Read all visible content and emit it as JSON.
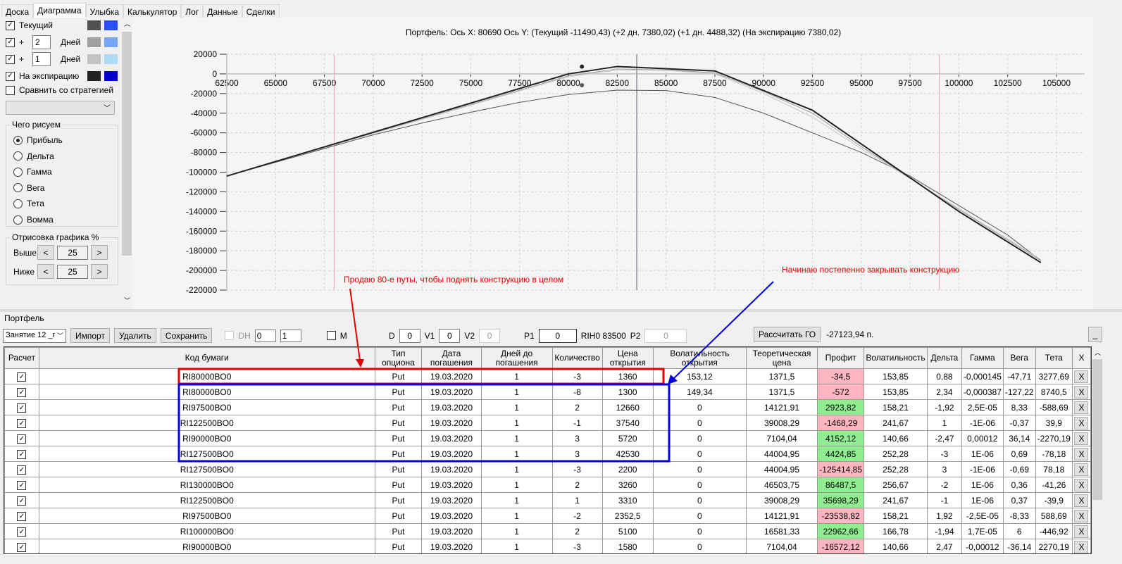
{
  "tabs": [
    "Доска",
    "Диаграмма",
    "Улыбка",
    "Калькулятор",
    "Лог",
    "Данные",
    "Сделки"
  ],
  "left": {
    "curves": [
      {
        "label": "Текущий",
        "checked": true,
        "days": null,
        "color1": "#505050",
        "color2": "#2a4ff5"
      },
      {
        "label": "+",
        "checked": true,
        "days": "2",
        "days_label": "Дней",
        "color1": "#a0a0a0",
        "color2": "#78a6f2"
      },
      {
        "label": "+",
        "checked": true,
        "days": "1",
        "days_label": "Дней",
        "color1": "#c3c3c3",
        "color2": "#aedaf7"
      },
      {
        "label": "На экспирацию",
        "checked": true,
        "days": null,
        "color1": "#222222",
        "color2": "#0000c8"
      }
    ],
    "compare_label": "Сравнить со стратегией",
    "draw_group": "Чего рисуем",
    "draw_options": [
      "Прибыль",
      "Дельта",
      "Гамма",
      "Вега",
      "Тета",
      "Вомма"
    ],
    "draw_selected": 0,
    "range_group": "Отрисовка графика %",
    "above_label": "Выше",
    "above_value": "25",
    "below_label": "Ниже",
    "below_value": "25",
    "prev": "<",
    "next": ">"
  },
  "chart_data": {
    "type": "line",
    "title": "Портфель: Ось X: 80690 Ось Y:  (Текущий -11490,43)  (+2 дн. 7380,02)  (+1 дн. 4488,32)  (На экспирацию 7380,02)",
    "xlim": [
      62500,
      105000
    ],
    "ylim": [
      -220000,
      20000
    ],
    "xticks": [
      62500,
      65000,
      67500,
      70000,
      72500,
      75000,
      77500,
      80000,
      82500,
      85000,
      87500,
      90000,
      92500,
      95000,
      97500,
      100000,
      102500,
      105000
    ],
    "yticks": [
      20000,
      0,
      -20000,
      -40000,
      -60000,
      -80000,
      -100000,
      -120000,
      -140000,
      -160000,
      -180000,
      -200000,
      -220000
    ],
    "grid": true,
    "vlines": [
      {
        "x": 68000,
        "color": "#f4a0a8"
      },
      {
        "x": 83500,
        "color": "#a0aab8"
      },
      {
        "x": 99000,
        "color": "#f4a0a8"
      }
    ],
    "series": [
      {
        "color": "#555555",
        "width": 1,
        "points": [
          [
            62500,
            -104000
          ],
          [
            65000,
            -90000
          ],
          [
            67500,
            -76000
          ],
          [
            70000,
            -62000
          ],
          [
            72500,
            -50000
          ],
          [
            75000,
            -39000
          ],
          [
            77500,
            -29000
          ],
          [
            80000,
            -21000
          ],
          [
            82500,
            -16500
          ],
          [
            85000,
            -17000
          ],
          [
            87500,
            -24000
          ],
          [
            90000,
            -40000
          ],
          [
            92500,
            -60000
          ],
          [
            95000,
            -80000
          ],
          [
            97500,
            -104000
          ],
          [
            100000,
            -134000
          ],
          [
            102500,
            -164000
          ],
          [
            104200,
            -190000
          ]
        ]
      },
      {
        "color": "#a0a0a0",
        "width": 1,
        "points": [
          [
            62500,
            -104000
          ],
          [
            80000,
            -2000
          ],
          [
            82500,
            5000
          ],
          [
            85000,
            4000
          ],
          [
            87500,
            1000
          ],
          [
            90000,
            -18000
          ],
          [
            92500,
            -40000
          ],
          [
            95000,
            -74000
          ],
          [
            100000,
            -138000
          ],
          [
            104200,
            -190000
          ]
        ]
      },
      {
        "color": "#c8c8c8",
        "width": 1,
        "points": [
          [
            62500,
            -104000
          ],
          [
            80000,
            -3000
          ],
          [
            82500,
            4000
          ],
          [
            85000,
            3500
          ],
          [
            87500,
            0
          ],
          [
            90000,
            -20000
          ],
          [
            92500,
            -44000
          ],
          [
            95000,
            -76000
          ],
          [
            100000,
            -137000
          ],
          [
            104200,
            -189000
          ]
        ]
      },
      {
        "color": "#222222",
        "width": 2,
        "points": [
          [
            62500,
            -104000
          ],
          [
            80000,
            0
          ],
          [
            82500,
            7500
          ],
          [
            87500,
            3000
          ],
          [
            92500,
            -37000
          ],
          [
            100000,
            -140000
          ],
          [
            104200,
            -192000
          ]
        ]
      }
    ],
    "markers": [
      {
        "x": 80690,
        "y": 7380,
        "color": "#222222"
      },
      {
        "x": 80690,
        "y": -11490,
        "color": "#555555"
      }
    ]
  },
  "annotations": {
    "red_text": "Продаю 80-е путы, чтобы поднять конструкцию в целом",
    "blue_text": "Начинаю постепенно закрывать конструкцию"
  },
  "portfolio": {
    "group_label": "Портфель",
    "select": "Занятие 12 _г",
    "import": "Импорт",
    "delete": "Удалить",
    "save": "Сохранить",
    "dh": "DH",
    "spin1": "0",
    "spin2": "1",
    "m": "M",
    "d_label": "D",
    "d": "0",
    "v1_label": "V1",
    "v1": "0",
    "v2_label": "V2",
    "v2": "0",
    "p1_label": "P1",
    "p1": "0",
    "rih": "RIH0 83500",
    "p2_label": "P2",
    "p2": "0",
    "calc": "Рассчитать ГО",
    "go_value": "-27123,94 п.",
    "minimize": "_"
  },
  "table": {
    "headers": [
      "Расчет",
      "Код бумаги",
      "Тип опциона",
      "Дата погашения",
      "Дней до погашения",
      "Количество",
      "Цена открытия",
      "Волатильность открытия",
      "Теоретическая цена",
      "Профит",
      "Волатильность",
      "Дельта",
      "Гамма",
      "Вега",
      "Тета",
      "X"
    ],
    "rows": [
      [
        "RI80000BO0",
        "Put",
        "19.03.2020",
        "1",
        "-3",
        "1360",
        "153,12",
        "1371,5",
        "-34,5",
        "153,85",
        "0,88",
        "-0,000145",
        "-47,71",
        "3277,69"
      ],
      [
        "RI80000BO0",
        "Put",
        "19.03.2020",
        "1",
        "-8",
        "1300",
        "149,34",
        "1371,5",
        "-572",
        "153,85",
        "2,34",
        "-0,000387",
        "-127,22",
        "8740,5"
      ],
      [
        "RI97500BO0",
        "Put",
        "19.03.2020",
        "1",
        "2",
        "12660",
        "0",
        "14121,91",
        "2923,82",
        "158,21",
        "-1,92",
        "2,5E-05",
        "8,33",
        "-588,69"
      ],
      [
        "RI122500BO0",
        "Put",
        "19.03.2020",
        "1",
        "-1",
        "37540",
        "0",
        "39008,29",
        "-1468,29",
        "241,67",
        "1",
        "-1E-06",
        "-0,37",
        "39,9"
      ],
      [
        "RI90000BO0",
        "Put",
        "19.03.2020",
        "1",
        "3",
        "5720",
        "0",
        "7104,04",
        "4152,12",
        "140,66",
        "-2,47",
        "0,00012",
        "36,14",
        "-2270,19"
      ],
      [
        "RI127500BO0",
        "Put",
        "19.03.2020",
        "1",
        "3",
        "42530",
        "0",
        "44004,95",
        "4424,85",
        "252,28",
        "-3",
        "1E-06",
        "0,69",
        "-78,18"
      ],
      [
        "RI127500BO0",
        "Put",
        "19.03.2020",
        "1",
        "-3",
        "2200",
        "0",
        "44004,95",
        "-125414,85",
        "252,28",
        "3",
        "-1E-06",
        "-0,69",
        "78,18"
      ],
      [
        "RI130000BO0",
        "Put",
        "19.03.2020",
        "1",
        "2",
        "3260",
        "0",
        "46503,75",
        "86487,5",
        "256,67",
        "-2",
        "1E-06",
        "0,36",
        "-41,26"
      ],
      [
        "RI122500BO0",
        "Put",
        "19.03.2020",
        "1",
        "1",
        "3310",
        "0",
        "39008,29",
        "35698,29",
        "241,67",
        "-1",
        "1E-06",
        "0,37",
        "-39,9"
      ],
      [
        "RI97500BO0",
        "Put",
        "19.03.2020",
        "1",
        "-2",
        "2352,5",
        "0",
        "14121,91",
        "-23538,82",
        "158,21",
        "1,92",
        "-2,5E-05",
        "-8,33",
        "588,69"
      ],
      [
        "RI100000BO0",
        "Put",
        "19.03.2020",
        "1",
        "2",
        "5100",
        "0",
        "16581,33",
        "22962,66",
        "166,78",
        "-1,94",
        "1,7E-05",
        "6",
        "-446,92"
      ],
      [
        "RI90000BO0",
        "Put",
        "19.03.2020",
        "1",
        "-3",
        "1580",
        "0",
        "7104,04",
        "-16572,12",
        "140,66",
        "2,47",
        "-0,00012",
        "-36,14",
        "2270,19"
      ]
    ],
    "delete_label": "X",
    "check": "✓"
  }
}
